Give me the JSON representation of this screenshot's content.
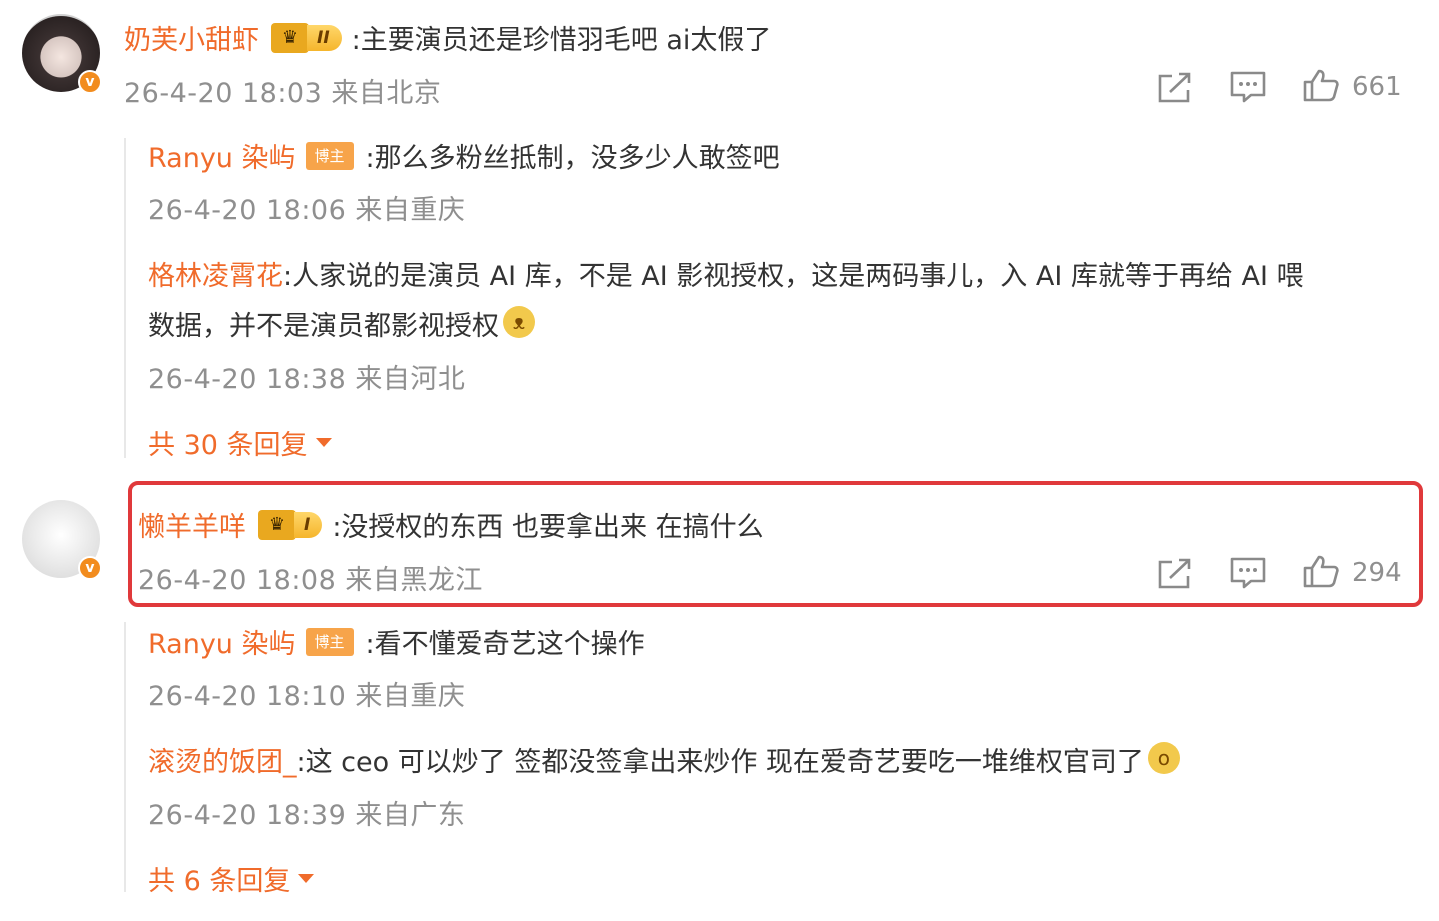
{
  "comments": [
    {
      "username": "奶芙小甜虾",
      "rank_label": "II",
      "text": ":主要演员还是珍惜羽毛吧 ai太假了",
      "meta": "26-4-20 18:03 来自北京",
      "likes": "661",
      "replies": [
        {
          "username": "Ranyu 染屿",
          "badge": "博主",
          "text": ":那么多粉丝抵制，没多少人敢签吧",
          "meta": "26-4-20 18:06 来自重庆"
        },
        {
          "username": "格林凌霄花",
          "text_line1": ":人家说的是演员 AI 库，不是 AI 影视授权，这是两码事儿，入 AI 库就等于再给 AI 喂",
          "text_line2": "数据，并不是演员都影视授权",
          "meta": "26-4-20 18:38 来自河北"
        }
      ],
      "more_replies": "共 30 条回复"
    },
    {
      "username": "懒羊羊咩",
      "rank_label": "I",
      "text": ":没授权的东西 也要拿出来 在搞什么",
      "meta": "26-4-20 18:08 来自黑龙江",
      "likes": "294",
      "replies": [
        {
          "username": "Ranyu 染屿",
          "badge": "博主",
          "text": ":看不懂爱奇艺这个操作",
          "meta": "26-4-20 18:10 来自重庆"
        },
        {
          "username": "滚烫的饭团_",
          "text": ":这 ceo 可以炒了  签都没签拿出来炒作  现在爱奇艺要吃一堆维权官司了",
          "meta": "26-4-20 18:39 来自广东"
        }
      ],
      "more_replies": "共 6 条回复"
    }
  ],
  "icons": {
    "share": "share-icon",
    "comment": "comment-icon",
    "like": "thumbs-up-icon",
    "verified": "verified-v-icon"
  },
  "colors": {
    "username": "#f06b2b",
    "meta": "#8f8f8f",
    "highlight_border": "#e0393b",
    "badge": "#f7a44a"
  }
}
